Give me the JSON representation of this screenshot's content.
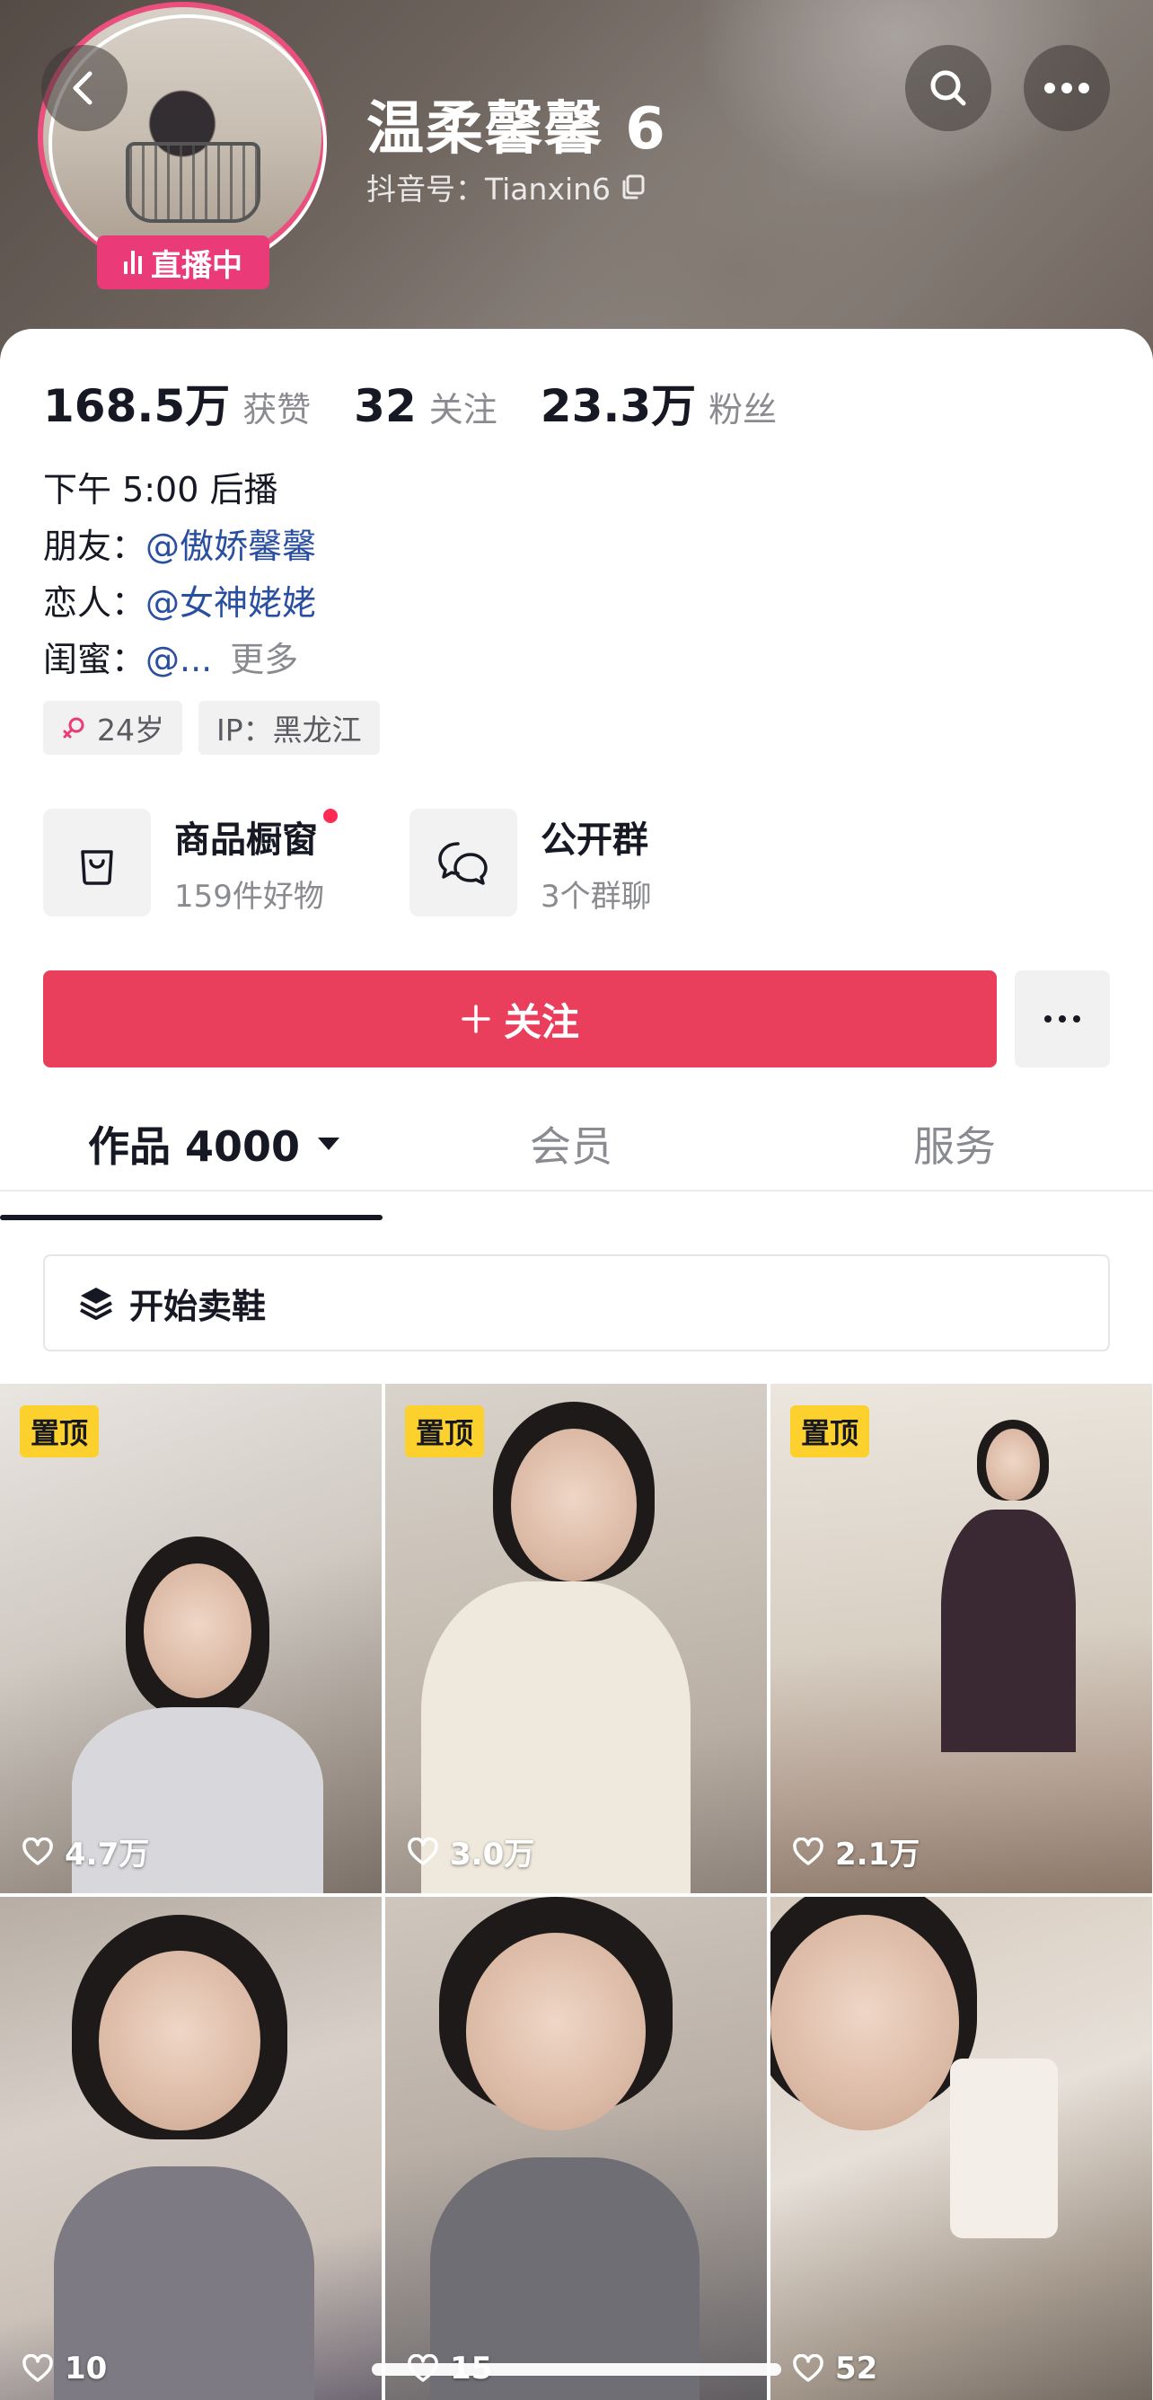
{
  "header": {
    "nickname": "温柔馨馨 6",
    "douyin_id": "抖音号：Tianxin6",
    "live_badge": "直播中"
  },
  "stats": [
    {
      "value": "168.5万",
      "label": "获赞"
    },
    {
      "value": "32",
      "label": "关注"
    },
    {
      "value": "23.3万",
      "label": "粉丝"
    }
  ],
  "bio": {
    "line1": "下午 5:00 后播",
    "friend_label": "朋友：",
    "friend_mention": "@傲娇馨馨",
    "lover_label": "恋人：",
    "lover_mention": "@女神姥姥",
    "bestie_label": "闺蜜：",
    "bestie_mention": "@...",
    "more": "更多"
  },
  "tags": {
    "age": "24岁",
    "ip": "IP：黑龙江"
  },
  "features": {
    "shop_title": "商品橱窗",
    "shop_sub": "159件好物",
    "group_title": "公开群",
    "group_sub": "3个群聊"
  },
  "actions": {
    "follow_label": "关注"
  },
  "tabs": {
    "works": "作品 4000",
    "member": "会员",
    "service": "服务"
  },
  "section": {
    "label": "开始卖鞋"
  },
  "videos": [
    {
      "pinned": "置顶",
      "likes": "4.7万"
    },
    {
      "pinned": "置顶",
      "likes": "3.0万"
    },
    {
      "pinned": "置顶",
      "likes": "2.1万"
    },
    {
      "pinned": "",
      "likes": "10"
    },
    {
      "pinned": "",
      "likes": "15"
    },
    {
      "pinned": "",
      "likes": "52"
    }
  ],
  "colors": {
    "accent": "#ea3f5c",
    "live_badge": "#ea3a78",
    "mention": "#2b4fa0",
    "pin": "#fcd12e"
  }
}
